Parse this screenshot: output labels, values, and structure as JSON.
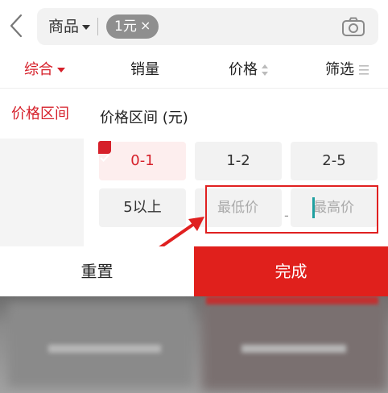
{
  "search": {
    "scope_label": "商品",
    "chip_label": "1元",
    "chip_remove": "×"
  },
  "sort": {
    "comprehensive": "综合",
    "sales": "销量",
    "price": "价格",
    "filter": "筛选"
  },
  "panel": {
    "nav_active": "价格区间",
    "section_title": "价格区间 (元)",
    "options": [
      "0-1",
      "1-2",
      "2-5",
      "5以上"
    ],
    "selected_option": "0-1",
    "min_placeholder": "最低价",
    "max_placeholder": "最高价",
    "range_separator": "-"
  },
  "buttons": {
    "reset": "重置",
    "done": "完成"
  },
  "colors": {
    "accent": "#d6202a",
    "done_button": "#e0201c",
    "annotation": "#e02020"
  }
}
